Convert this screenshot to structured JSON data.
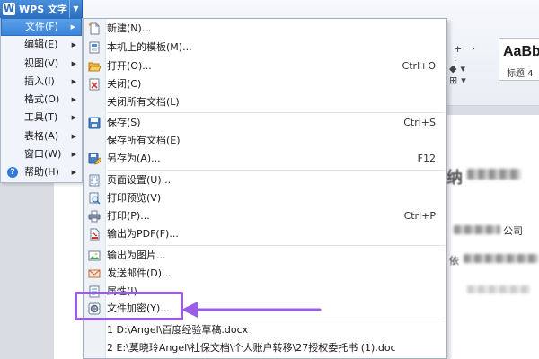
{
  "app": {
    "title": "WPS 文字",
    "logo_letter": "W"
  },
  "app_menu": {
    "items": [
      {
        "label": "文件(F)",
        "active": true
      },
      {
        "label": "编辑(E)",
        "active": false
      },
      {
        "label": "视图(V)",
        "active": false
      },
      {
        "label": "插入(I)",
        "active": false
      },
      {
        "label": "格式(O)",
        "active": false
      },
      {
        "label": "工具(T)",
        "active": false
      },
      {
        "label": "表格(A)",
        "active": false
      },
      {
        "label": "窗口(W)",
        "active": false
      },
      {
        "label": "帮助(H)",
        "active": false
      }
    ]
  },
  "file_menu": {
    "items": [
      {
        "label": "新建(N)...",
        "shortcut": "",
        "icon": "new-doc-icon"
      },
      {
        "label": "本机上的模板(M)...",
        "shortcut": "",
        "icon": "template-icon"
      },
      {
        "label": "打开(O)...",
        "shortcut": "Ctrl+O",
        "icon": "open-folder-icon"
      },
      {
        "label": "关闭(C)",
        "shortcut": "",
        "icon": "close-doc-icon"
      },
      {
        "label": "关闭所有文档(L)",
        "shortcut": "",
        "icon": ""
      },
      {
        "label": "保存(S)",
        "shortcut": "Ctrl+S",
        "icon": "save-icon"
      },
      {
        "label": "保存所有文档(E)",
        "shortcut": "",
        "icon": ""
      },
      {
        "label": "另存为(A)...",
        "shortcut": "F12",
        "icon": "save-as-icon"
      },
      {
        "label": "页面设置(U)...",
        "shortcut": "",
        "icon": "page-setup-icon"
      },
      {
        "label": "打印预览(V)",
        "shortcut": "",
        "icon": "print-preview-icon"
      },
      {
        "label": "打印(P)...",
        "shortcut": "Ctrl+P",
        "icon": "print-icon"
      },
      {
        "label": "输出为PDF(F)...",
        "shortcut": "",
        "icon": "pdf-icon"
      },
      {
        "label": "输出为图片...",
        "shortcut": "",
        "icon": "export-image-icon"
      },
      {
        "label": "发送邮件(D)...",
        "shortcut": "",
        "icon": "mail-icon"
      },
      {
        "label": "属性(I)...",
        "shortcut": "",
        "icon": "properties-icon"
      },
      {
        "label": "文件加密(Y)...",
        "shortcut": "",
        "icon": "encrypt-icon"
      }
    ],
    "recent_files": [
      "1 D:\\Angel\\百度经验草稿.docx",
      "2 E:\\莫晓玲Angel\\社保文档\\个人账户转移\\27授权委托书 (1).doc"
    ]
  },
  "ribbon": {
    "style_sample": "AaBbC",
    "style_name": "标题 4"
  },
  "document": {
    "heading_fragment": "纳",
    "company_fragment": "公司",
    "line_fragment": "依"
  },
  "colors": {
    "annotation": "#9b5de5",
    "menu_active": "#3c84d8",
    "app_button": "#2d6fc0"
  }
}
